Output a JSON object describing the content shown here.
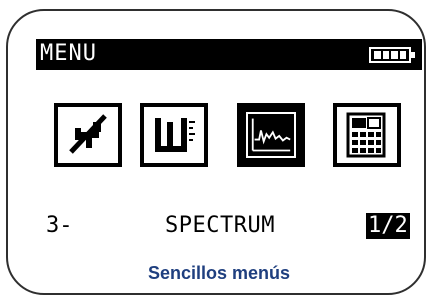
{
  "screen": {
    "menu_title": "MENU",
    "battery_icon": "battery-full-icon",
    "icons": [
      {
        "name": "no-signal-icon",
        "selected": false
      },
      {
        "name": "thermometer-level-icon",
        "selected": false
      },
      {
        "name": "spectrum-waveform-icon",
        "selected": true
      },
      {
        "name": "calculator-keypad-icon",
        "selected": false
      }
    ],
    "selected_index_label": "3-",
    "selected_item_label": "SPECTRUM",
    "page_indicator": "1/2"
  },
  "caption": "Sencillos menús",
  "colors": {
    "screen_fg": "#000000",
    "screen_bg": "#ffffff",
    "caption": "#1f3f7f",
    "frame": "#2f2f2f"
  }
}
